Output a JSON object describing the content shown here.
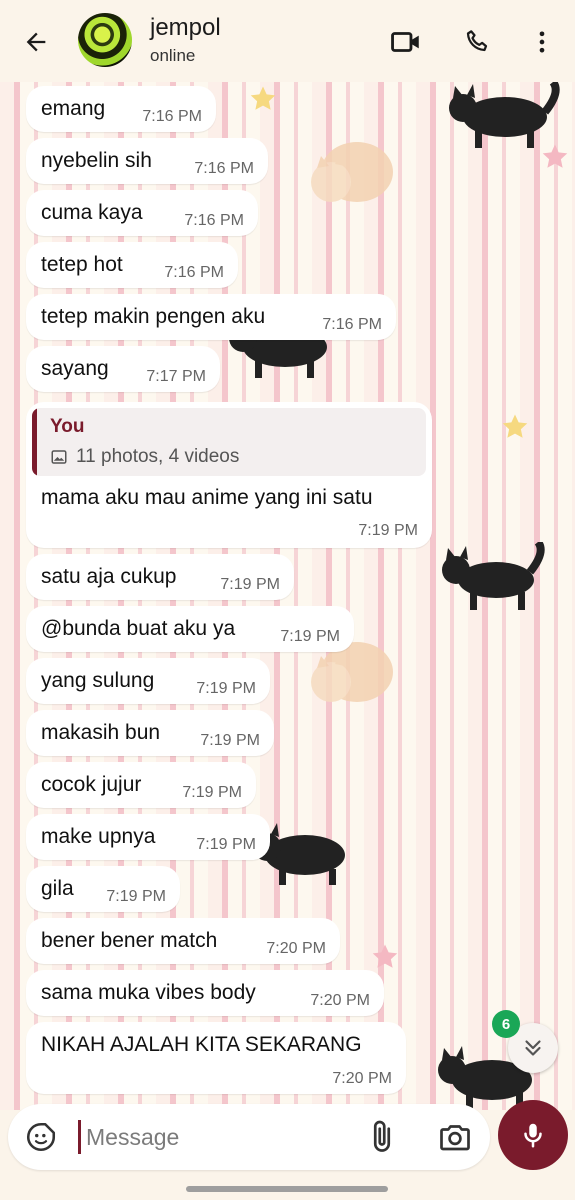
{
  "header": {
    "contact_name": "jempol",
    "status": "online"
  },
  "messages": [
    {
      "text": "emang",
      "time": "7:16 PM"
    },
    {
      "text": "nyebelin sih",
      "time": "7:16 PM"
    },
    {
      "text": "cuma kaya",
      "time": "7:16 PM"
    },
    {
      "text": "tetep hot",
      "time": "7:16 PM"
    },
    {
      "text": "tetep makin pengen aku",
      "time": "7:16 PM"
    },
    {
      "text": "sayang",
      "time": "7:17 PM"
    }
  ],
  "quoted_message": {
    "author": "You",
    "media": "11 photos, 4 videos",
    "text": "mama aku mau anime yang ini satu",
    "time": "7:19 PM"
  },
  "messages_after": [
    {
      "text": "satu aja cukup",
      "time": "7:19 PM"
    },
    {
      "text": "@bunda buat aku ya",
      "time": "7:19 PM"
    },
    {
      "text": "yang sulung",
      "time": "7:19 PM"
    },
    {
      "text": "makasih bun",
      "time": "7:19 PM"
    },
    {
      "text": "cocok jujur",
      "time": "7:19 PM"
    },
    {
      "text": "make upnya",
      "time": "7:19 PM"
    },
    {
      "text": "gila",
      "time": "7:19 PM"
    },
    {
      "text": "bener bener match",
      "time": "7:20 PM"
    },
    {
      "text": "sama muka vibes body",
      "time": "7:20 PM"
    },
    {
      "text": "NIKAH AJALAH KITA SEKARANG",
      "time": "7:20 PM"
    }
  ],
  "scroll": {
    "unread_count": "6"
  },
  "input": {
    "placeholder": "Message"
  },
  "colors": {
    "accent": "#7a1b2c",
    "unread_badge": "#1aa757",
    "bubble": "#ffffff",
    "header_bg": "#fbf4ea"
  },
  "icons": [
    "back-arrow-icon",
    "video-call-icon",
    "phone-icon",
    "more-vert-icon",
    "image-icon",
    "double-chevron-down-icon",
    "sticker-icon",
    "paperclip-icon",
    "camera-icon",
    "mic-icon"
  ]
}
